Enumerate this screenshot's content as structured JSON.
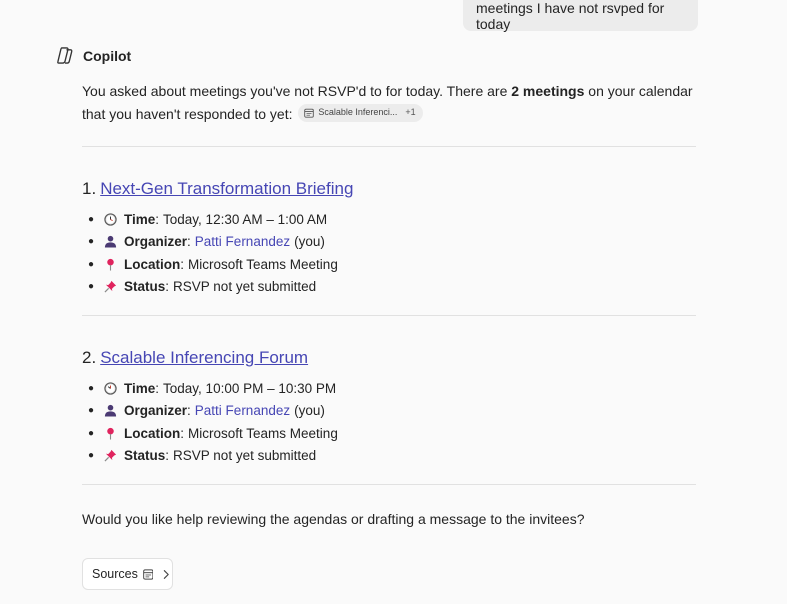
{
  "user_message": "meetings I have not rsvped for today",
  "assistant": {
    "name": "Copilot",
    "intro_part1": "You asked about meetings you've not RSVP'd to for today. There are ",
    "intro_bold": "2 meetings",
    "intro_part2": " on your calendar that you haven't responded to yet: ",
    "citation_label": "Scalable Inferenci...",
    "citation_more": "+1"
  },
  "meetings": [
    {
      "number": "1.",
      "title": "Next-Gen Transformation Briefing",
      "time_key": "Time",
      "time_value": "Today, 12:30 AM – 1:00 AM",
      "organizer_key": "Organizer",
      "organizer_name": "Patti Fernandez",
      "organizer_suffix": "(you)",
      "location_key": "Location",
      "location_value": "Microsoft Teams Meeting",
      "status_key": "Status",
      "status_value": "RSVP not yet submitted"
    },
    {
      "number": "2.",
      "title": "Scalable Inferencing Forum",
      "time_key": "Time",
      "time_value": "Today, 10:00 PM – 10:30 PM",
      "organizer_key": "Organizer",
      "organizer_name": "Patti Fernandez",
      "organizer_suffix": "(you)",
      "location_key": "Location",
      "location_value": "Microsoft Teams Meeting",
      "status_key": "Status",
      "status_value": "RSVP not yet submitted"
    }
  ],
  "followup": "Would you like help reviewing the agendas or drafting a message to the invitees?",
  "sources_label": "Sources",
  "icons": {
    "time": "clock-icon",
    "organizer": "person-icon",
    "location": "pin-icon",
    "status": "pushpin-icon"
  },
  "colors": {
    "link": "#4646b4",
    "background": "#fafafa",
    "user_bubble": "#ececec"
  }
}
